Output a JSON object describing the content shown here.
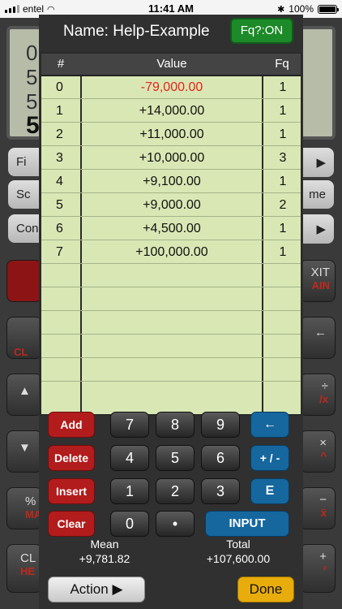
{
  "status_bar": {
    "carrier": "entel",
    "time": "11:41 AM",
    "battery": "100%"
  },
  "background": {
    "lcd_lines": [
      "0.",
      "5.",
      "5.",
      "5"
    ],
    "buttons": [
      "Fi",
      "Sc",
      "Con",
      "me"
    ],
    "keys": [
      "XIT",
      "AIN",
      "CL",
      "MA",
      "CL",
      "HE"
    ]
  },
  "header": {
    "title": "Name: Help-Example",
    "fq_toggle": "Fq?:ON"
  },
  "table": {
    "columns": [
      "#",
      "Value",
      "Fq"
    ],
    "rows": [
      {
        "idx": "0",
        "value": "-79,000.00",
        "fq": "1"
      },
      {
        "idx": "1",
        "value": "+14,000.00",
        "fq": "1"
      },
      {
        "idx": "2",
        "value": "+11,000.00",
        "fq": "1"
      },
      {
        "idx": "3",
        "value": "+10,000.00",
        "fq": "3"
      },
      {
        "idx": "4",
        "value": "+9,100.00",
        "fq": "1"
      },
      {
        "idx": "5",
        "value": "+9,000.00",
        "fq": "2"
      },
      {
        "idx": "6",
        "value": "+4,500.00",
        "fq": "1"
      },
      {
        "idx": "7",
        "value": "+100,000.00",
        "fq": "1"
      }
    ]
  },
  "keypad": {
    "add": "Add",
    "delete": "Delete",
    "insert": "Insert",
    "clear": "Clear",
    "n7": "7",
    "n8": "8",
    "n9": "9",
    "n4": "4",
    "n5": "5",
    "n6": "6",
    "n1": "1",
    "n2": "2",
    "n3": "3",
    "n0": "0",
    "dot": "•",
    "backspace": "←",
    "sign": "+ / -",
    "exp": "E",
    "input": "INPUT"
  },
  "stats": {
    "mean_label": "Mean",
    "mean_value": "+9,781.82",
    "total_label": "Total",
    "total_value": "+107,600.00"
  },
  "footer": {
    "action": "Action ▶",
    "done": "Done"
  }
}
